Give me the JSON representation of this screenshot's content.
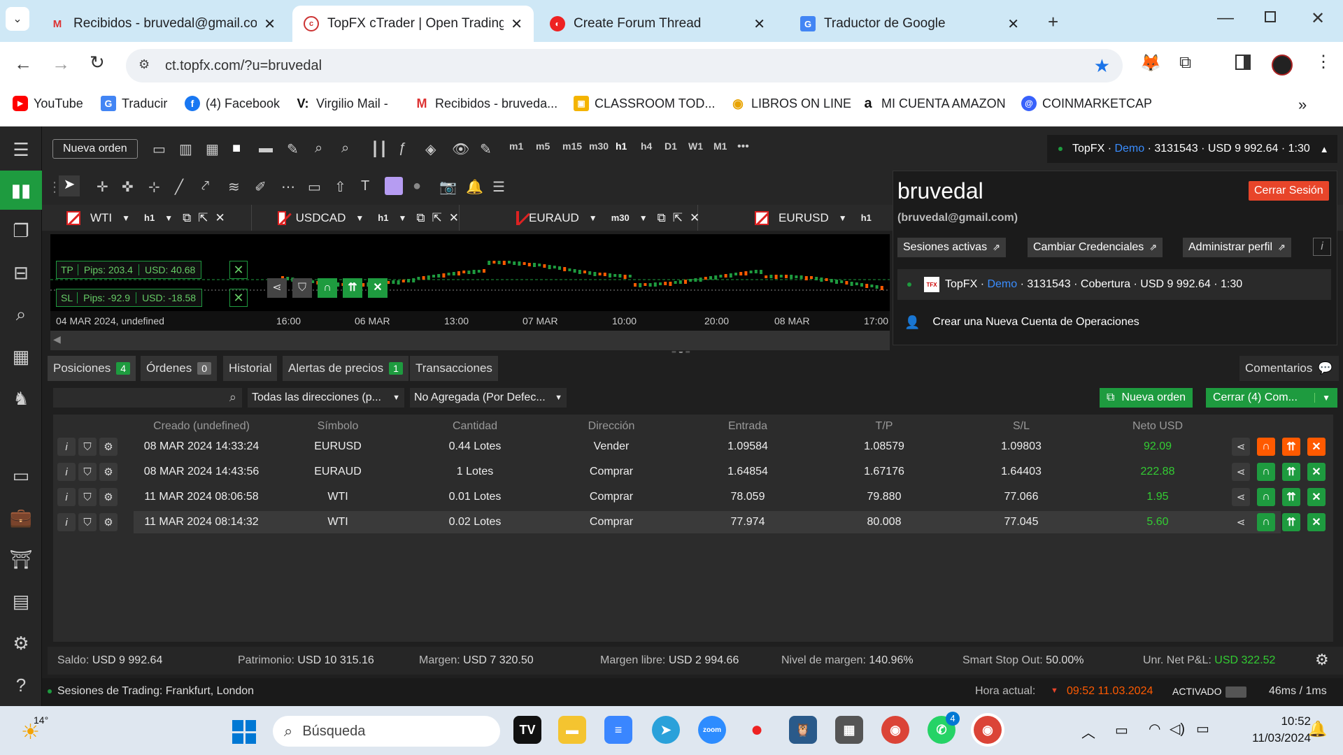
{
  "browser": {
    "tabs": [
      {
        "title": "Recibidos - bruvedal@gmail.com",
        "active": false,
        "icon": "gmail-icon"
      },
      {
        "title": "TopFX cTrader | Open Trading Platform",
        "active": true,
        "icon": "ctrader-icon"
      },
      {
        "title": "Create Forum Thread",
        "active": false,
        "icon": "forum-icon"
      },
      {
        "title": "Traductor de Google",
        "active": false,
        "icon": "translate-icon"
      }
    ],
    "url": "ct.topfx.com/?u=bruvedal",
    "bookmarks": [
      "YouTube",
      "Traducir",
      "(4) Facebook",
      "Virgilio Mail -",
      "Recibidos - bruveda...",
      "CLASSROOM TOD...",
      "LIBROS ON LINE",
      "MI CUENTA AMAZON",
      "COINMARKETCAP"
    ]
  },
  "toolbar": {
    "new_order": "Nueva orden",
    "timeframes": [
      "m1",
      "m5",
      "m15",
      "m30",
      "h1",
      "h4",
      "D1",
      "W1",
      "M1"
    ],
    "more": "•••"
  },
  "account_bar": {
    "broker": "TopFX",
    "mode": "Demo",
    "details": "· 3131543 · USD 9 992.64 · 1:30"
  },
  "popup": {
    "username": "bruvedal",
    "email": "(bruvedal@gmail.com)",
    "logout": "Cerrar Sesión",
    "buttons": [
      "Sesiones activas",
      "Cambiar Credenciales",
      "Administrar perfil"
    ],
    "account": {
      "broker": "TopFX",
      "mode": "Demo",
      "details": "· 3131543 · Cobertura · USD 9 992.64 · 1:30"
    },
    "new_account": "Crear una Nueva Cuenta de Operaciones"
  },
  "chart_tabs": [
    {
      "symbol": "WTI",
      "tf": "h1"
    },
    {
      "symbol": "USDCAD",
      "tf": "h1"
    },
    {
      "symbol": "EURAUD",
      "tf": "m30"
    },
    {
      "symbol": "EURUSD",
      "tf": "h1"
    }
  ],
  "chart": {
    "tp": {
      "label": "TP",
      "pips": "Pips: 203.4",
      "usd": "USD: 40.68"
    },
    "sl": {
      "label": "SL",
      "pips": "Pips: -92.9",
      "usd": "USD: -18.58"
    },
    "axis_labels": [
      "04 MAR 2024, undefined",
      "16:00",
      "06 MAR",
      "13:00",
      "07 MAR",
      "10:00",
      "20:00",
      "08 MAR",
      "17:00"
    ]
  },
  "panel": {
    "tabs": [
      {
        "label": "Posiciones",
        "badge": "4",
        "badge_color": "green"
      },
      {
        "label": "Órdenes",
        "badge": "0",
        "badge_color": "grey"
      },
      {
        "label": "Historial",
        "badge": ""
      },
      {
        "label": "Alertas de precios",
        "badge": "1",
        "badge_color": "green"
      },
      {
        "label": "Transacciones",
        "badge": ""
      }
    ],
    "comments": "Comentarios",
    "filter_direction": "Todas las direcciones (p...",
    "filter_aggregate": "No Agregada (Por Defec...",
    "new_order": "Nueva orden",
    "close_all": "Cerrar (4) Com...",
    "columns": [
      "Creado (undefined)",
      "Símbolo",
      "Cantidad",
      "Dirección",
      "Entrada",
      "T/P",
      "S/L",
      "Neto USD"
    ],
    "rows": [
      {
        "created": "08 MAR 2024 14:33:24",
        "symbol": "EURUSD",
        "qty": "0.44 Lotes",
        "dir": "Vender",
        "entry": "1.09584",
        "tp": "1.08579",
        "sl": "1.09803",
        "net": "92.09"
      },
      {
        "created": "08 MAR 2024 14:43:56",
        "symbol": "EURAUD",
        "qty": "1 Lotes",
        "dir": "Comprar",
        "entry": "1.64854",
        "tp": "1.67176",
        "sl": "1.64403",
        "net": "222.88"
      },
      {
        "created": "11 MAR 2024 08:06:58",
        "symbol": "WTI",
        "qty": "0.01 Lotes",
        "dir": "Comprar",
        "entry": "78.059",
        "tp": "79.880",
        "sl": "77.066",
        "net": "1.95"
      },
      {
        "created": "11 MAR 2024 08:14:32",
        "symbol": "WTI",
        "qty": "0.02 Lotes",
        "dir": "Comprar",
        "entry": "77.974",
        "tp": "80.008",
        "sl": "77.045",
        "net": "5.60"
      }
    ]
  },
  "summary": {
    "saldo_label": "Saldo:",
    "saldo": "USD 9 992.64",
    "patrimonio_label": "Patrimonio:",
    "patrimonio": "USD 10 315.16",
    "margen_label": "Margen:",
    "margen": "USD 7 320.50",
    "margen_libre_label": "Margen libre:",
    "margen_libre": "USD 2 994.66",
    "nivel_label": "Nivel de margen:",
    "nivel": "140.96%",
    "smart_label": "Smart Stop Out:",
    "smart": "50.00%",
    "unr_label": "Unr. Net P&L:",
    "unr": "USD 322.52"
  },
  "status": {
    "sessions": "Sesiones de Trading: Frankfurt, London",
    "time_label": "Hora actual:",
    "time": "09:52 11.03.2024",
    "activated": "ACTIVADO",
    "latency": "46ms",
    "latency2": "1ms"
  },
  "taskbar": {
    "weather": "14°",
    "search": "Búsqueda",
    "time": "10:52",
    "date": "11/03/2024",
    "whatsapp_badge": "4"
  },
  "colors": {
    "accent_green": "#1e9b3f",
    "accent_orange": "#ff5a00",
    "logout_red": "#e8452a",
    "demo_blue": "#3a8dff"
  }
}
